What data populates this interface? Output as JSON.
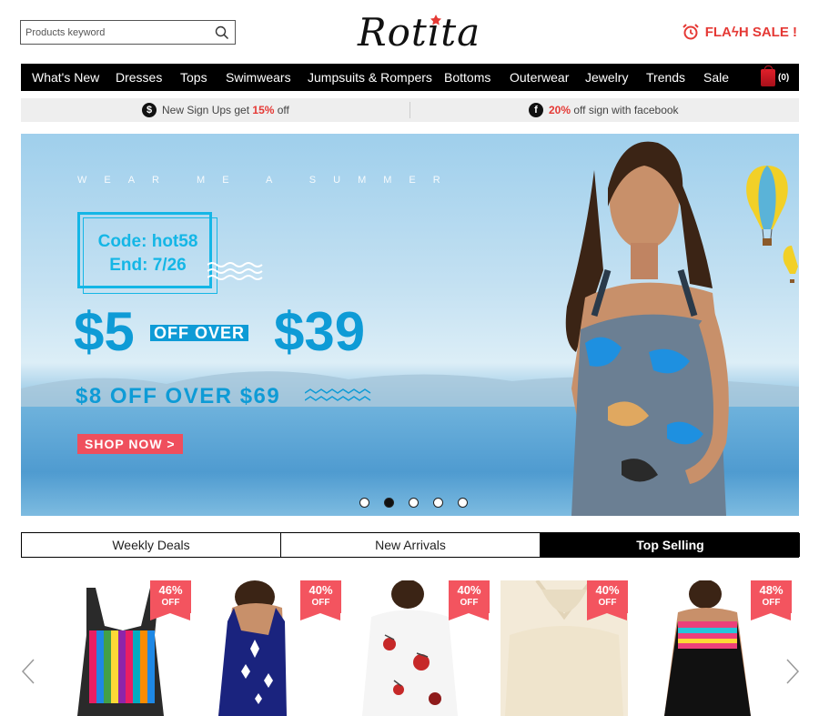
{
  "header": {
    "search_placeholder": "Products keyword",
    "logo_text": "Rotita",
    "flash_sale": "FLAϟH SALE !"
  },
  "nav": {
    "items": [
      "What's New",
      "Dresses",
      "Tops",
      "Swimwears",
      "Jumpsuits & Rompers",
      "Bottoms",
      "Outerwear",
      "Jewelry",
      "Trends",
      "Sale"
    ],
    "cart_count": "(0)"
  },
  "promo": {
    "left": {
      "prefix": "New Sign Ups get ",
      "highlight": "15%",
      "suffix": " off"
    },
    "right": {
      "highlight": "20%",
      "suffix": " off sign with facebook"
    }
  },
  "banner": {
    "tagline": "WEAR ME A SUMMER",
    "code_line": "Code: hot58",
    "end_line": "End: 7/26",
    "big_left": "$5",
    "off_over": "OFF OVER",
    "big_right": "$39",
    "sub": "$8 OFF OVER $69",
    "shop_now": "SHOP NOW >",
    "slide_count": 5,
    "active_slide": 2
  },
  "tabs": [
    "Weekly Deals",
    "New Arrivals",
    "Top Selling"
  ],
  "active_tab": 2,
  "products": [
    {
      "discount": "46%",
      "off": "OFF",
      "colors": [
        "#e91e63",
        "#1e88e5",
        "#43a047",
        "#fdd835",
        "#8e24aa"
      ]
    },
    {
      "discount": "40%",
      "off": "OFF",
      "colors": [
        "#1a237e",
        "#ffffff"
      ]
    },
    {
      "discount": "40%",
      "off": "OFF",
      "colors": [
        "#f5f5f5",
        "#c62828"
      ]
    },
    {
      "discount": "40%",
      "off": "OFF",
      "colors": [
        "#f3ead8"
      ]
    },
    {
      "discount": "48%",
      "off": "OFF",
      "colors": [
        "#111111",
        "#ec407a",
        "#26c6da"
      ]
    }
  ],
  "colors": {
    "accent_red": "#e53935",
    "banner_blue": "#0e9bd6",
    "code_cyan": "#14b6e6",
    "badge_red": "#f3545f"
  }
}
